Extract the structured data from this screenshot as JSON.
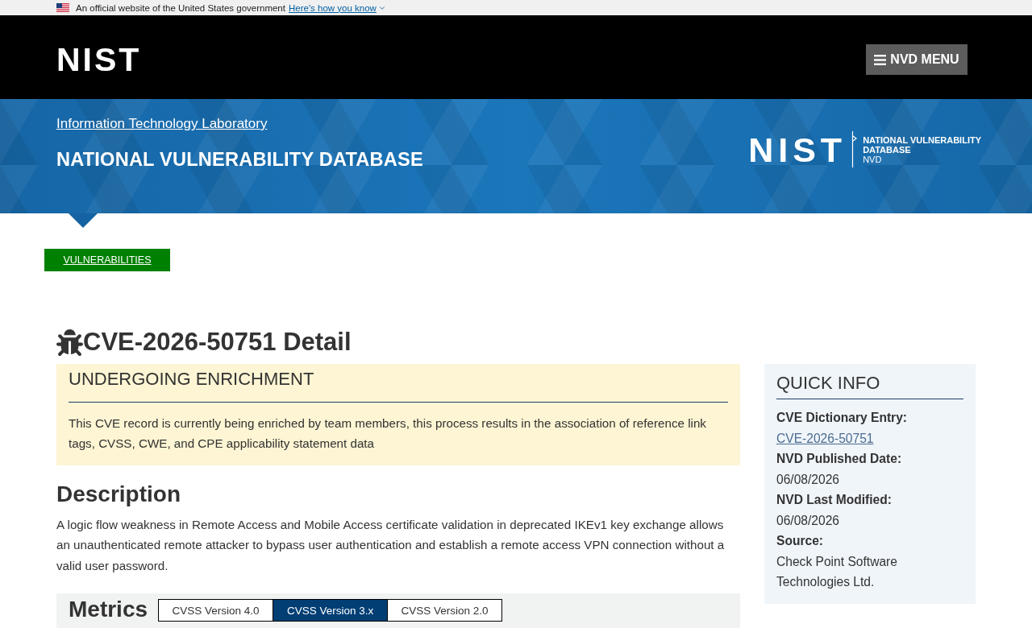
{
  "gov_banner": {
    "text": "An official website of the United States government",
    "link": "Here's how you know"
  },
  "header": {
    "logo": "NIST",
    "menu_button": "NVD MENU"
  },
  "banner": {
    "lab_link": "Information Technology Laboratory",
    "title": "NATIONAL VULNERABILITY DATABASE",
    "nvd_logo": {
      "mark": "NIST",
      "name_lines": [
        "NATIONAL VULNERABILITY",
        "DATABASE"
      ],
      "abbreviation": "NVD"
    }
  },
  "breadcrumb": {
    "label": "VULNERABILITIES"
  },
  "page_title": "CVE-2026-50751 Detail",
  "enrichment": {
    "title": "UNDERGOING ENRICHMENT",
    "text": "This CVE record is currently being enriched by team members, this process results in the association of reference link tags, CVSS, CWE, and CPE applicability statement data"
  },
  "description": {
    "heading": "Description",
    "text": "A logic flow weakness in Remote Access and Mobile Access certificate validation in deprecated IKEv1 key exchange allows an unauthenticated remote attacker to bypass user authentication and establish a remote access VPN connection without a valid user password."
  },
  "metrics": {
    "heading": "Metrics",
    "tabs": [
      {
        "label": "CVSS Version 4.0",
        "selected": false
      },
      {
        "label": "CVSS Version 3.x",
        "selected": true
      },
      {
        "label": "CVSS Version 2.0",
        "selected": false
      }
    ]
  },
  "quick_info": {
    "title": "QUICK INFO",
    "fields": [
      {
        "label": "CVE Dictionary Entry:",
        "value": "CVE-2026-50751",
        "kind": "link"
      },
      {
        "label": "NVD Published Date:",
        "value": "06/08/2026",
        "kind": "text"
      },
      {
        "label": "NVD Last Modified:",
        "value": "06/08/2026",
        "kind": "text"
      },
      {
        "label": "Source:",
        "value": "Check Point Software Technologies Ltd.",
        "kind": "text"
      }
    ]
  }
}
